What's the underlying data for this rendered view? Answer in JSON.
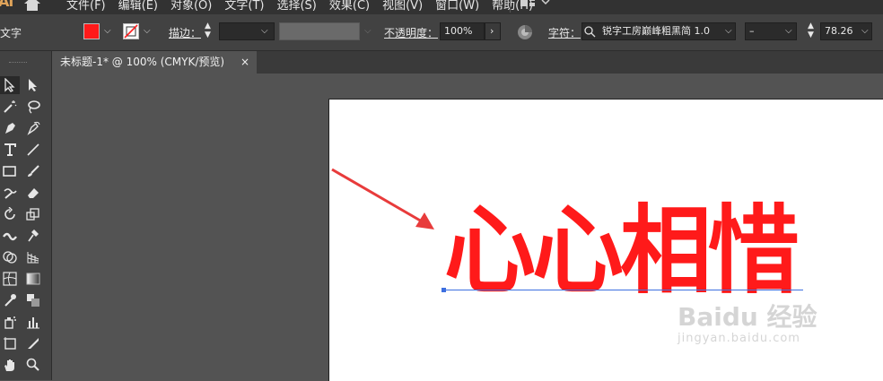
{
  "app": {
    "logo": "AI",
    "menu": [
      "文件(F)",
      "编辑(E)",
      "对象(O)",
      "文字(T)",
      "选择(S)",
      "效果(C)",
      "视图(V)",
      "窗口(W)",
      "帮助(H)"
    ]
  },
  "control_bar": {
    "object_type": "文字",
    "fill_color": "#ff1a1a",
    "stroke_label": "描边：",
    "stroke_weight": "",
    "opacity_label": "不透明度：",
    "opacity_value": "100%",
    "char_label": "字符：",
    "font_name": "锐字工房巅峰粗黑简 1.0",
    "font_style": "–",
    "font_size": "78.26"
  },
  "document_tab": {
    "title": "未标题-1* @ 100% (CMYK/预览)",
    "close": "×"
  },
  "canvas": {
    "headline_text": "心心相惜",
    "headline_color": "#ff1a1a",
    "watermark_logo": "Baidu 经验",
    "watermark_url": "jingyan.baidu.com"
  },
  "tools": [
    "selection-tool",
    "direct-selection-tool",
    "magic-wand-tool",
    "lasso-tool",
    "pen-tool",
    "curvature-tool",
    "type-tool",
    "line-tool",
    "rectangle-tool",
    "paintbrush-tool",
    "shaper-tool",
    "eraser-tool",
    "rotate-tool",
    "scale-tool",
    "width-tool",
    "puppet-warp-tool",
    "shape-builder-tool",
    "perspective-grid-tool",
    "mesh-tool",
    "gradient-tool",
    "eyedropper-tool",
    "blend-tool",
    "symbol-sprayer-tool",
    "column-graph-tool",
    "artboard-tool",
    "slice-tool",
    "hand-tool",
    "zoom-tool"
  ]
}
